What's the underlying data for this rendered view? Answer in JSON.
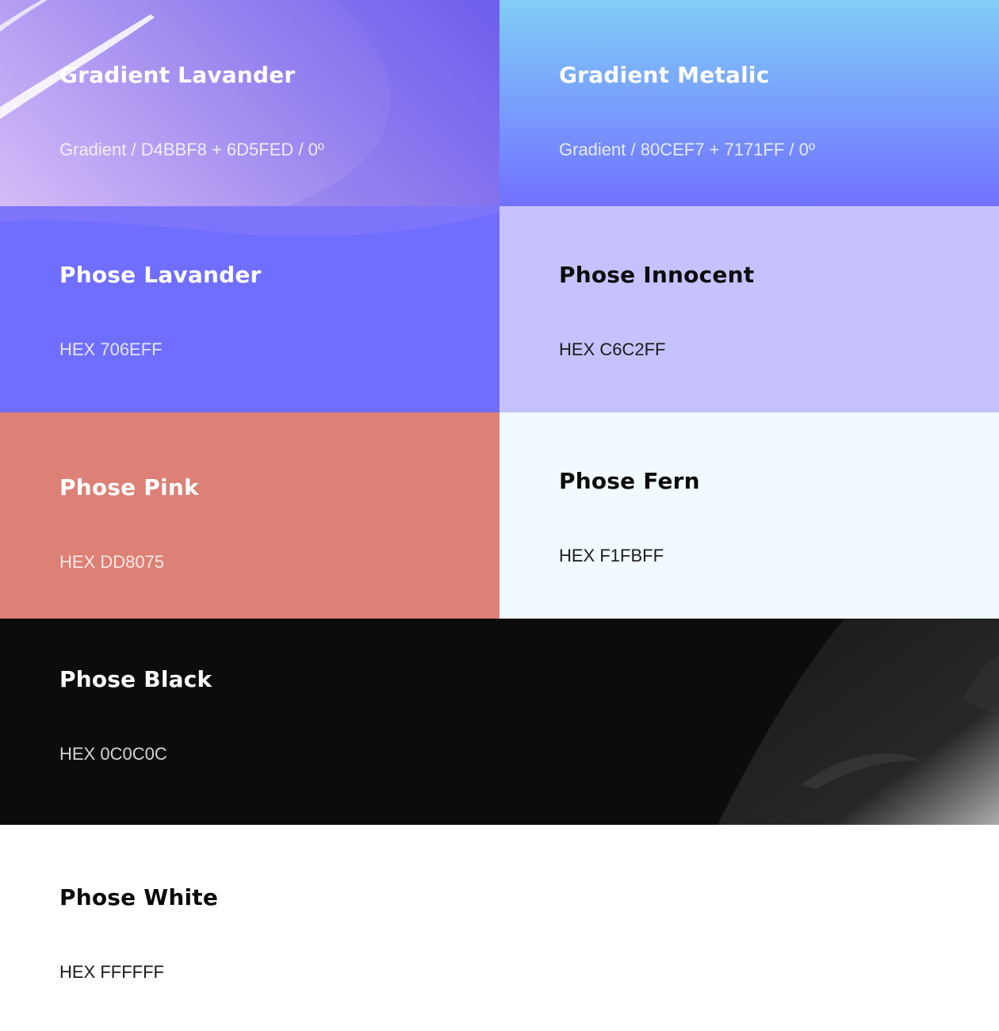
{
  "swatches": [
    {
      "name": "Gradient Lavander",
      "code": "Gradient / D4BBF8 + 6D5FED / 0º",
      "colors": [
        "#D4BBF8",
        "#6D5FED"
      ]
    },
    {
      "name": "Gradient Metalic",
      "code": "Gradient / 80CEF7 + 7171FF / 0º",
      "colors": [
        "#80CEF7",
        "#7171FF"
      ]
    },
    {
      "name": "Phose Lavander",
      "code": "HEX 706EFF",
      "color": "#706EFF"
    },
    {
      "name": "Phose Innocent",
      "code": "HEX C6C2FF",
      "color": "#C6C2FF"
    },
    {
      "name": "Phose Pink",
      "code": "HEX DD8075",
      "color": "#DD8075"
    },
    {
      "name": "Phose Fern",
      "code": "HEX F1FBFF",
      "color": "#F1FBFF"
    },
    {
      "name": "Phose Black",
      "code": "HEX 0C0C0C",
      "color": "#0C0C0C"
    },
    {
      "name": "Phose White",
      "code": "HEX FFFFFF",
      "color": "#FFFFFF"
    }
  ]
}
